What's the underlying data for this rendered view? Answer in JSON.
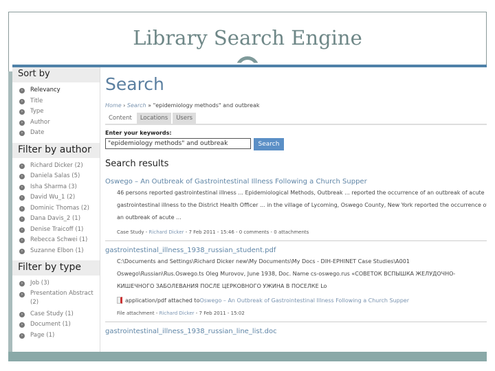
{
  "slide": {
    "title": "Library Search Engine"
  },
  "sidebar": {
    "sort": {
      "heading": "Sort by",
      "items": [
        "Relevancy",
        "Title",
        "Type",
        "Author",
        "Date"
      ]
    },
    "author": {
      "heading": "Filter by author",
      "items": [
        "Richard Dicker (2)",
        "Daniela Salas (5)",
        "Isha Sharma (3)",
        "David Wu_1 (2)",
        "Dominic Thomas (2)",
        "Dana Davis_2 (1)",
        "Denise Traicoff (1)",
        "Rebecca Schwei (1)",
        "Suzanne Elbon (1)"
      ]
    },
    "type": {
      "heading": "Filter by type",
      "items": [
        "Job (3)",
        "Presentation Abstract (2)",
        "Case Study (1)",
        "Document (1)",
        "Page (1)"
      ]
    }
  },
  "main": {
    "title": "Search",
    "breadcrumb": {
      "home": "Home",
      "search": "Search",
      "query": " » \"epidemiology methods\" and outbreak"
    },
    "tabs": [
      "Content",
      "Locations",
      "Users"
    ],
    "keywords_label": "Enter your keywords:",
    "keywords_value": "\"epidemiology methods\" and outbreak",
    "search_button": "Search",
    "results_heading": "Search results",
    "results": [
      {
        "title": "Oswego – An Outbreak of Gastrointestinal Illness Following a Church Supper",
        "snippet1": "46 persons reported gastrointestinal illness ... Epidemiological Methods, Outbreak ... reported the occurrence of an outbreak of acute",
        "snippet2": "gastrointestinal illness to the District Health Officer ... in the village of Lycoming, Oswego County, New York reported the occurrence of",
        "snippet3": "an outbreak of acute ...",
        "meta_type": "Case Study - ",
        "meta_author": "Richard Dicker",
        "meta_rest": " - 7 Feb 2011 - 15:46 - 0 comments - 0 attachments"
      },
      {
        "title": "gastrointestinal_illness_1938_russian_student.pdf",
        "snippet1": "C:\\Documents and Settings\\Richard Dicker new\\My Documents\\My Docs - DIH-EPHINET Case Studies\\A001",
        "snippet2": "Oswego\\Russian\\Rus.Oswego.ts Oleg Murovov, June 1938, Doc. Name cs-oswego.rus «СОВЕТОК ВСПЫШКА ЖЕЛУДОЧНО-",
        "snippet3": "КИШЕЧНОГО ЗАБОЛЕВАНИЯ ПОСЛЕ ЦЕРКОВНОГО УЖИНА В ПОСЕЛКЕ Lo",
        "attachment_label": "application/pdf attached to ",
        "attachment_link": "Oswego – An Outbreak of Gastrointestinal Illness Following a Church Supper",
        "meta_type": "File attachment - ",
        "meta_author": "Richard Dicker",
        "meta_rest": " - 7 Feb 2011 - 15:02"
      },
      {
        "title": "gastrointestinal_illness_1938_russian_line_list.doc"
      }
    ]
  },
  "colors": {
    "accent": "#4f81a8",
    "link": "#5f85a6",
    "button": "#5b8fc6",
    "band": "#8aa9a8"
  }
}
